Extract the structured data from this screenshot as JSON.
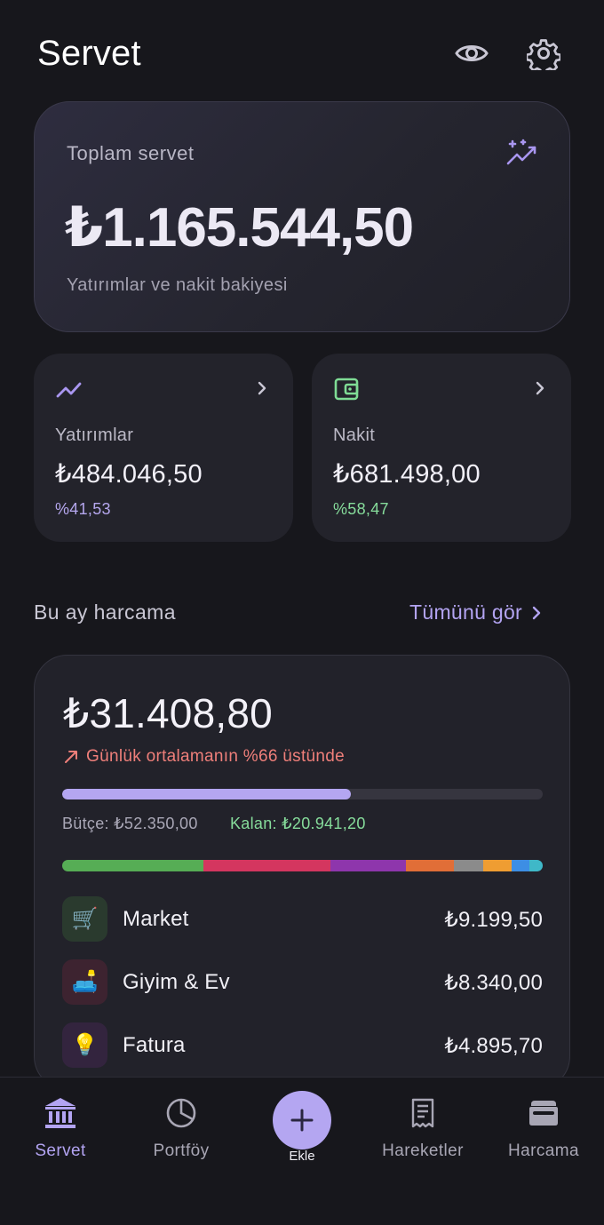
{
  "header": {
    "title": "Servet",
    "icons": [
      "eye-icon",
      "gear-icon"
    ]
  },
  "total": {
    "label": "Toplam servet",
    "value": "₺1.165.544,50",
    "subtitle": "Yatırımlar ve nakit bakiyesi",
    "icon": "sparkle-chart-icon"
  },
  "investments": {
    "label": "Yatırımlar",
    "value": "₺484.046,50",
    "percent": "%41,53",
    "icon": "trend-up-icon"
  },
  "cash": {
    "label": "Nakit",
    "value": "₺681.498,00",
    "percent": "%58,47",
    "icon": "wallet-icon"
  },
  "spending": {
    "section_title": "Bu ay harcama",
    "see_all": "Tümünü gör",
    "value": "₺31.408,80",
    "trend": "Günlük ortalamanın %66 üstünde",
    "budget_label": "Bütçe: ₺52.350,00",
    "remaining_label": "Kalan: ₺20.941,20",
    "budget_used_fraction": 0.6,
    "category_mix": [
      {
        "color": "#56ad55",
        "share": 0.293
      },
      {
        "color": "#d4365f",
        "share": 0.266
      },
      {
        "color": "#8e36ac",
        "share": 0.156
      },
      {
        "color": "#e16e37",
        "share": 0.1
      },
      {
        "color": "#8b8b8b",
        "share": 0.062
      },
      {
        "color": "#ef9d32",
        "share": 0.058
      },
      {
        "color": "#3d8ee4",
        "share": 0.038
      },
      {
        "color": "#3fb8c8",
        "share": 0.027
      }
    ],
    "categories": [
      {
        "name": "Market",
        "amount": "₺9.199,50",
        "emoji": "🛒",
        "bg": "#2a3a2e"
      },
      {
        "name": "Giyim & Ev",
        "amount": "₺8.340,00",
        "emoji": "🛋️",
        "bg": "#3d2330"
      },
      {
        "name": "Fatura",
        "amount": "₺4.895,70",
        "emoji": "💡",
        "bg": "#33243e"
      }
    ]
  },
  "nav": {
    "items": [
      {
        "label": "Servet",
        "icon": "bank-icon",
        "active": true
      },
      {
        "label": "Portföy",
        "icon": "pie-chart-icon",
        "active": false
      },
      {
        "label": "Ekle",
        "icon": "plus-icon",
        "active": false
      },
      {
        "label": "Hareketler",
        "icon": "receipt-icon",
        "active": false
      },
      {
        "label": "Harcama",
        "icon": "wallet-icon",
        "active": false
      }
    ]
  },
  "colors": {
    "accent": "#b4a6f1",
    "positive": "#86dc9b",
    "negative": "#ef7f7a",
    "background": "#17171c"
  }
}
